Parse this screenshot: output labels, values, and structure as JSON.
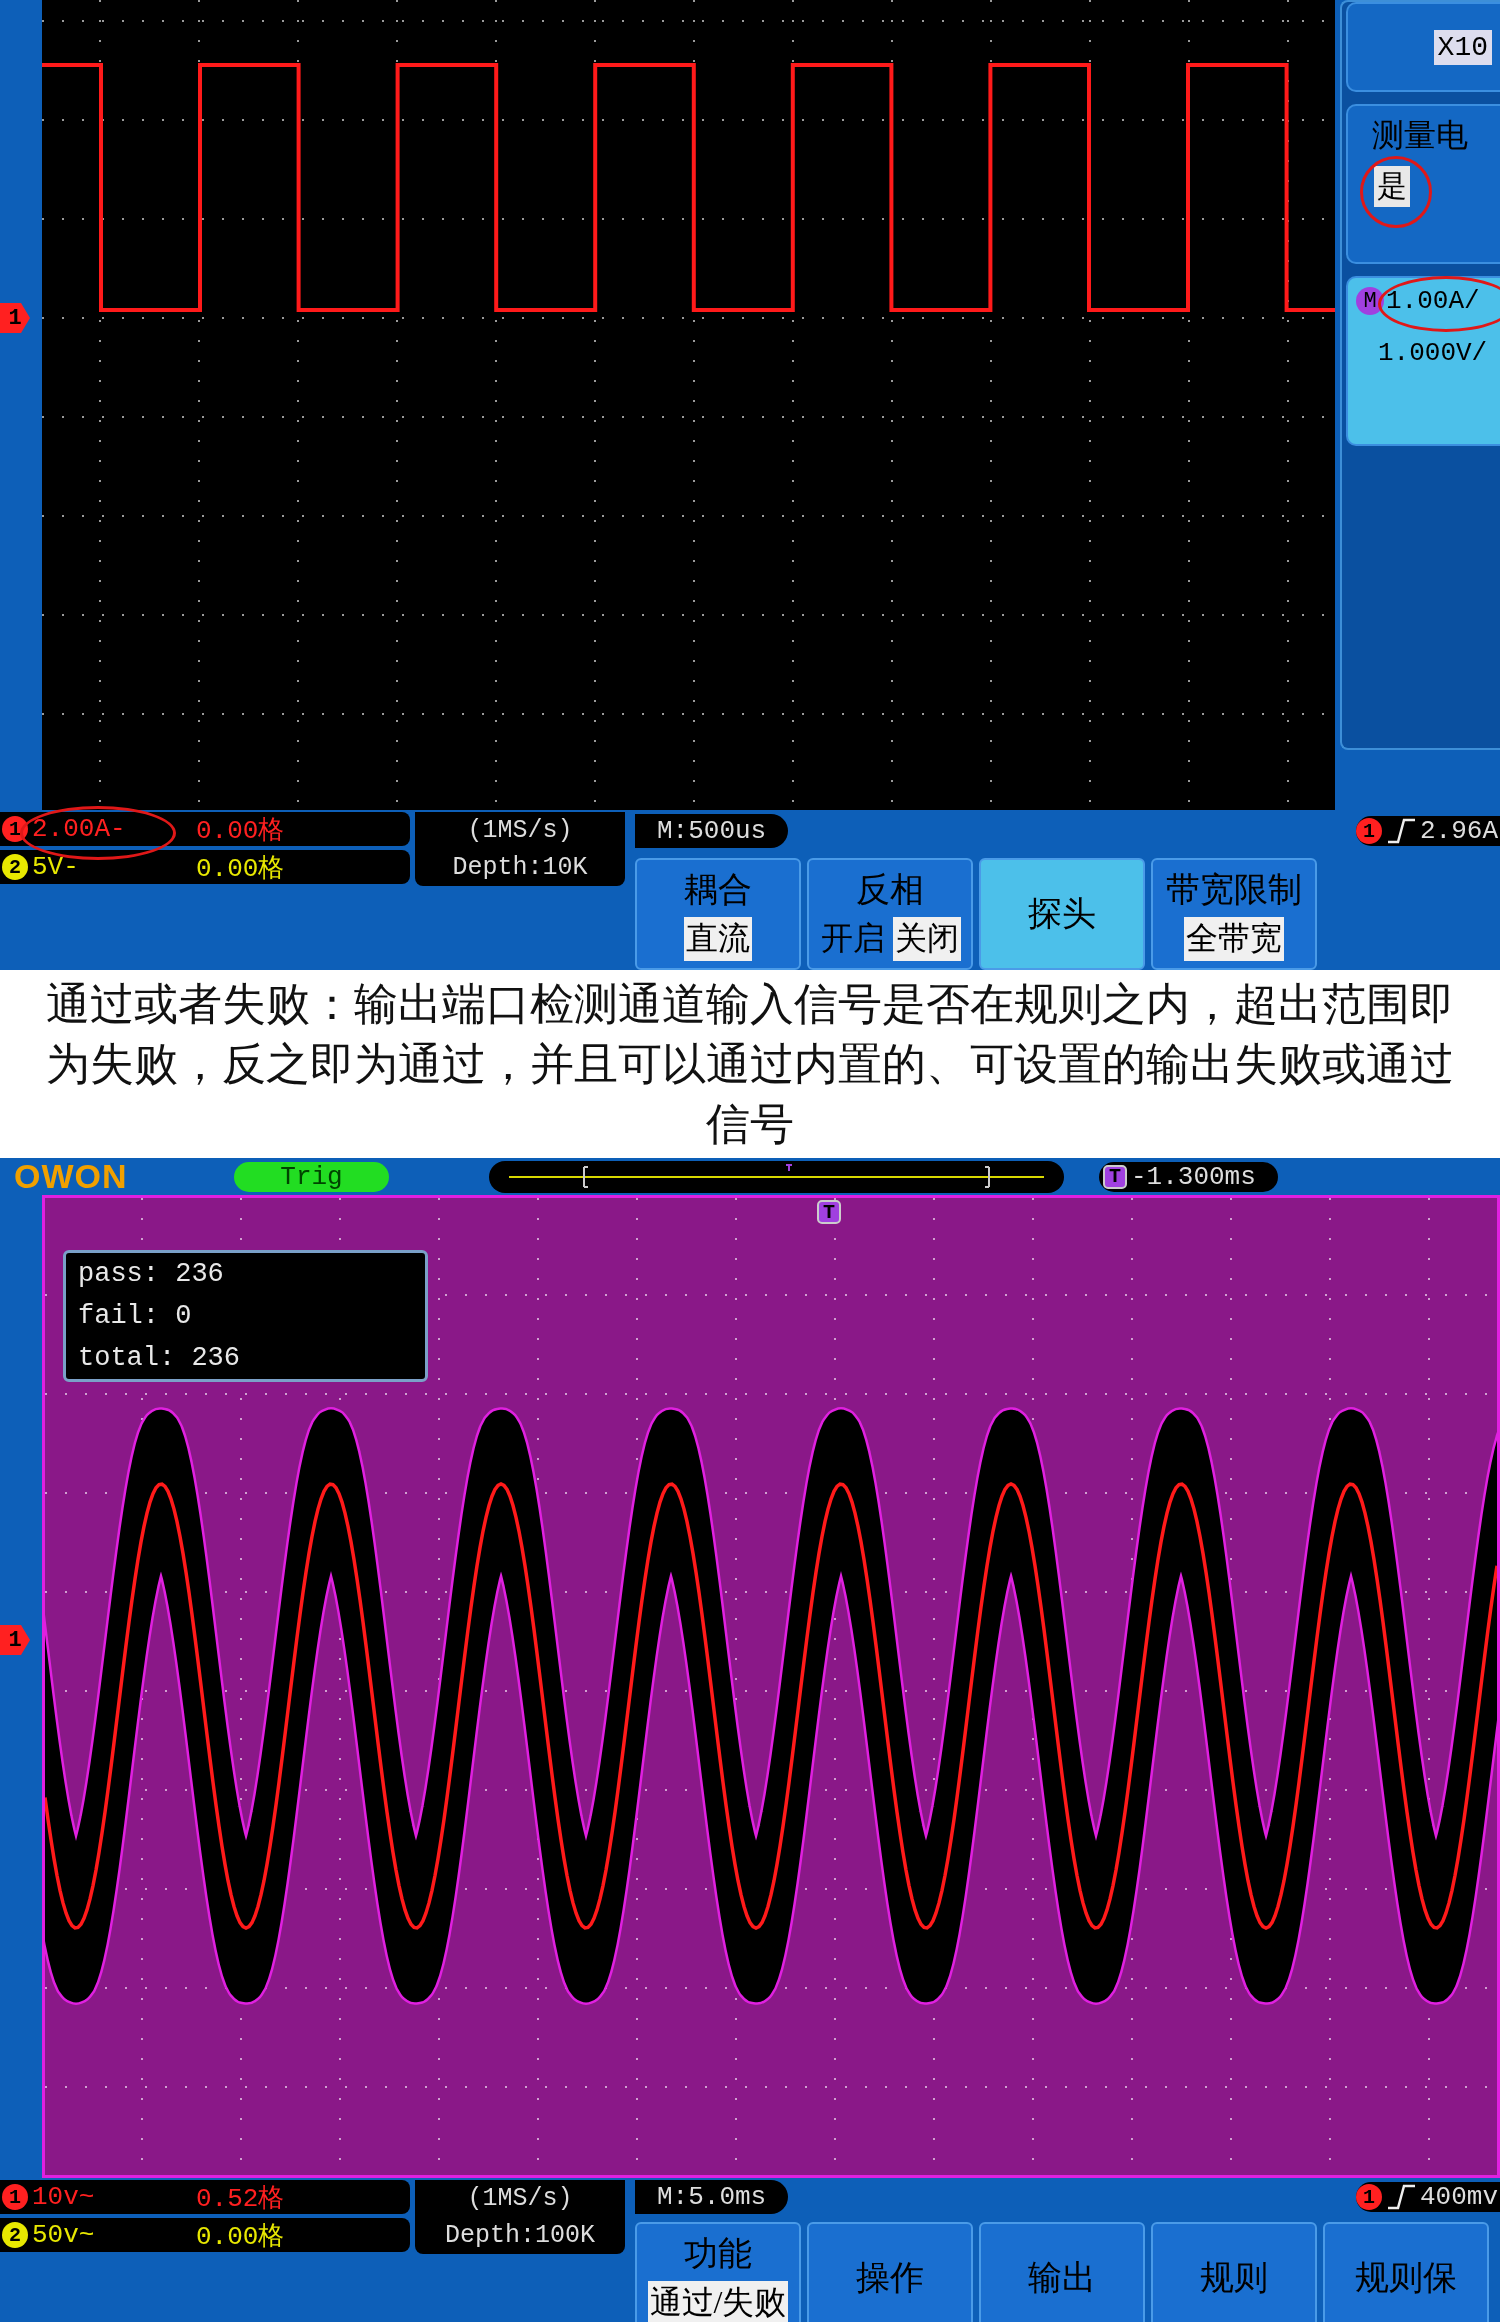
{
  "top_scope": {
    "channel_marker": "1",
    "side_panel": {
      "probe": "X10",
      "measure_label": "测量电",
      "measure_option": "是",
      "math_badge": "M",
      "math_lines": [
        "1.00A/",
        "1.000V/"
      ]
    },
    "status": {
      "channels": [
        {
          "badge": "1",
          "scale": "2.00A-",
          "offset": "0.00格",
          "color": "#ff2020"
        },
        {
          "badge": "2",
          "scale": "5V-",
          "offset": "0.00格",
          "color": "#e8e800"
        }
      ],
      "sample_rate": "(1MS/s)",
      "depth": "Depth:10K",
      "timebase": "M:500us",
      "trigger_badge": "1",
      "trigger_level": "2.96A"
    },
    "softkeys": [
      {
        "title": "耦合",
        "selected": false,
        "options": [
          {
            "text": "直流",
            "selected": true
          }
        ]
      },
      {
        "title": "反相",
        "selected": false,
        "options": [
          {
            "text": "开启",
            "selected": false
          },
          {
            "text": "关闭",
            "selected": true
          }
        ]
      },
      {
        "title": "探头",
        "selected": true
      },
      {
        "title": "带宽限制",
        "selected": false,
        "options": [
          {
            "text": "全带宽",
            "selected": true
          }
        ]
      }
    ]
  },
  "caption": "通过或者失败：输出端口检测通道输入信号是否在规则之内，超出范围即为失败，反之即为通过，并且可以通过内置的、可设置的输出失败或通过信号",
  "bottom_scope": {
    "logo": "OWON",
    "trigger_status": "Trig",
    "trigger_icon": "T",
    "trigger_offset": "-1.300ms",
    "canvas_trigger_icon": "T",
    "channel_marker": "1",
    "pass_fail": [
      "pass: 236",
      "fail: 0",
      "total: 236"
    ],
    "status": {
      "channels": [
        {
          "badge": "1",
          "scale": "10v~",
          "offset": "0.52格",
          "color": "#ff2020"
        },
        {
          "badge": "2",
          "scale": "50v~",
          "offset": "0.00格",
          "color": "#e8e800"
        }
      ],
      "sample_rate": "(1MS/s)",
      "depth": "Depth:100K",
      "timebase": "M:5.0ms",
      "trigger_badge": "1",
      "trigger_level": "400mv"
    },
    "softkeys": [
      {
        "title": "功能",
        "selected": false,
        "options": [
          {
            "text": "通过/失败",
            "selected": true
          }
        ]
      },
      {
        "title": "操作",
        "selected": false
      },
      {
        "title": "输出",
        "selected": false
      },
      {
        "title": "规则",
        "selected": false
      },
      {
        "title": "规则保",
        "selected": false
      }
    ]
  }
}
